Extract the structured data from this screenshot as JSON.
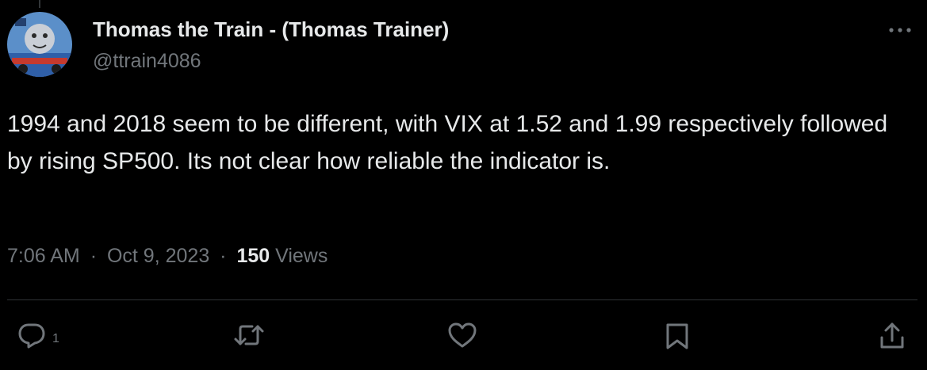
{
  "tweet": {
    "author": {
      "display_name": "Thomas the Train - (Thomas Trainer)",
      "handle": "@ttrain4086"
    },
    "text": "1994 and 2018 seem to be different,  with VIX at 1.52 and 1.99 respectively followed by rising SP500.   Its not clear how reliable the indicator is.",
    "time": "7:06 AM",
    "date": "Oct 9, 2023",
    "separator": "·",
    "views_count": "150",
    "views_label": "Views"
  },
  "actions": {
    "reply_count": "1"
  },
  "icons": {
    "more": "more-horizontal-icon",
    "reply": "reply-icon",
    "retweet": "retweet-icon",
    "like": "heart-icon",
    "bookmark": "bookmark-icon",
    "share": "share-icon"
  },
  "colors": {
    "background": "#000000",
    "primary_text": "#e7e9ea",
    "secondary_text": "#71767b",
    "divider": "#2f3336"
  }
}
